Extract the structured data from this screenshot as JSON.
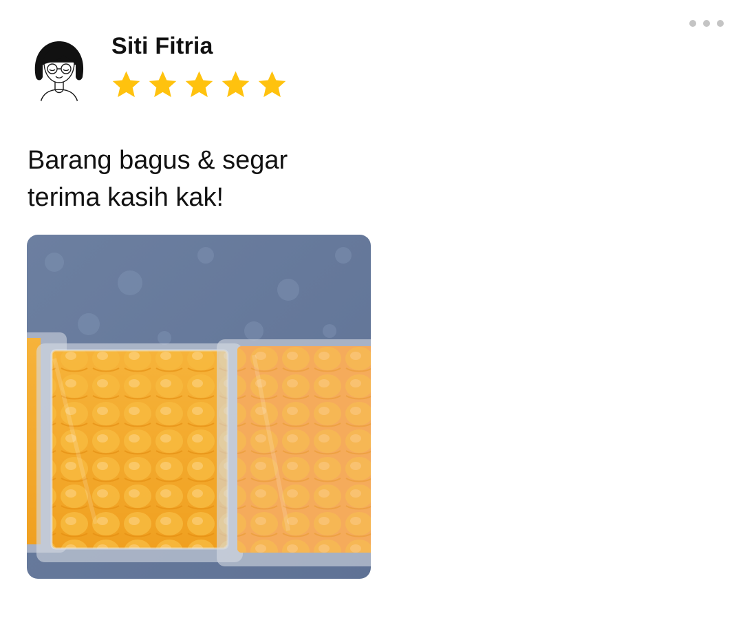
{
  "review": {
    "reviewer_name": "Siti Fitria",
    "rating": 5,
    "max_rating": 5,
    "text_lines": [
      "Barang bagus & segar",
      "terima kasih kak!"
    ]
  },
  "icons": {
    "more": "more-horizontal-icon",
    "star": "star-icon"
  },
  "colors": {
    "star": "#FFC20E",
    "more_dots": "#C4C4C4",
    "text": "#111111",
    "photo_background": "#6B7E9E",
    "photo_food": "#F5A81C"
  }
}
